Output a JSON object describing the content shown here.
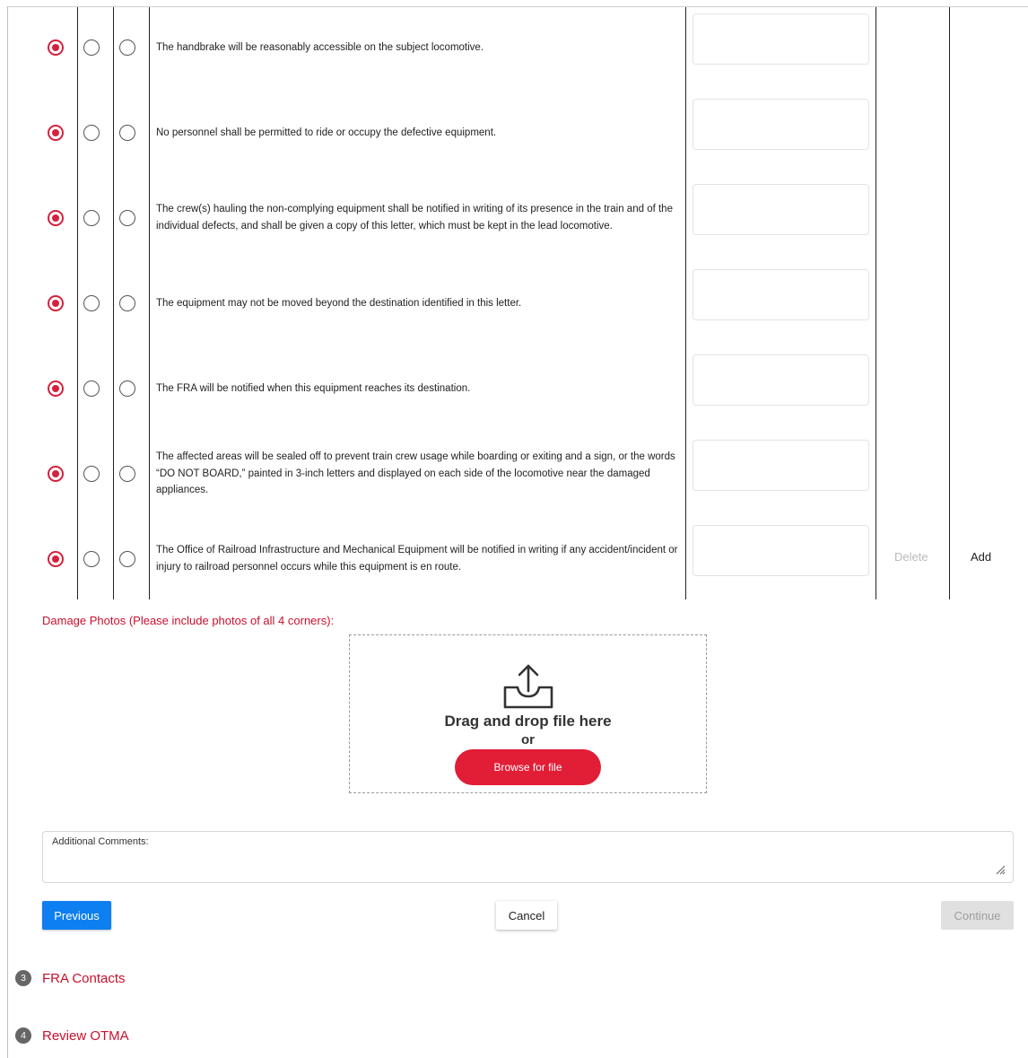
{
  "conditions": [
    {
      "text": "The handbrake will be reasonably accessible on the subject locomotive.",
      "selected": 0
    },
    {
      "text": "No personnel shall be permitted to ride or occupy the defective equipment.",
      "selected": 0
    },
    {
      "text": "The crew(s) hauling the non-complying equipment shall be notified in writing of its presence in the train and of the individual defects, and shall be given a copy of this letter, which must be kept in the lead locomotive.",
      "selected": 0
    },
    {
      "text": "The equipment may not be moved beyond the destination identified in this letter.",
      "selected": 0
    },
    {
      "text": "The FRA will be notified when this equipment reaches its destination.",
      "selected": 0
    },
    {
      "text": "The affected areas will be sealed off to prevent train crew usage while boarding or exiting and a sign, or the words “DO NOT BOARD,” painted in 3-inch letters and displayed on each side of the locomotive near the damaged appliances.",
      "selected": 0
    },
    {
      "text": "The Office of Railroad Infrastructure and Mechanical Equipment will be notified in writing if any accident/incident or injury to railroad personnel occurs while this equipment is en route.",
      "selected": 0
    }
  ],
  "row_actions": {
    "delete": "Delete",
    "add": "Add"
  },
  "photos": {
    "label": "Damage Photos (Please include photos of all 4 corners):",
    "drop_text": "Drag and drop file here",
    "or_text": "or",
    "browse": "Browse for file"
  },
  "comments": {
    "label": "Additional Comments:",
    "value": ""
  },
  "buttons": {
    "previous": "Previous",
    "cancel": "Cancel",
    "continue": "Continue"
  },
  "steps": [
    {
      "num": "3",
      "title": "FRA Contacts"
    },
    {
      "num": "4",
      "title": "Review OTMA"
    }
  ],
  "colors": {
    "accent": "#d4213d",
    "primary": "#0d7ff0",
    "browse": "#e21d36",
    "link": "#c8102e"
  }
}
